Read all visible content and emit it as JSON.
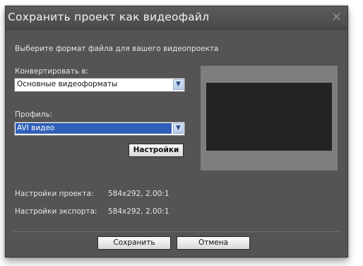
{
  "dialog": {
    "title": "Сохранить проект как видеофайл",
    "close_glyph": "✕",
    "intro": "Выберите формат файла для вашего видеопроекта",
    "convert_label": "Конвертировать в:",
    "convert_value": "Основные видеоформаты",
    "profile_label": "Профиль:",
    "profile_value": "AVI видео",
    "settings_button": "Настройки",
    "project_settings_label": "Настройки проекта:",
    "project_settings_value": "584x292, 2.00:1",
    "export_settings_label": "Настройки экспорта:",
    "export_settings_value": "584x292, 2.00:1",
    "save_button": "Сохранить",
    "cancel_button": "Отмена",
    "dropdown_arrow": "▼"
  },
  "colors": {
    "dialog_bg": "#545454",
    "selection": "#2f5fb8",
    "preview_screen": "#232323"
  }
}
